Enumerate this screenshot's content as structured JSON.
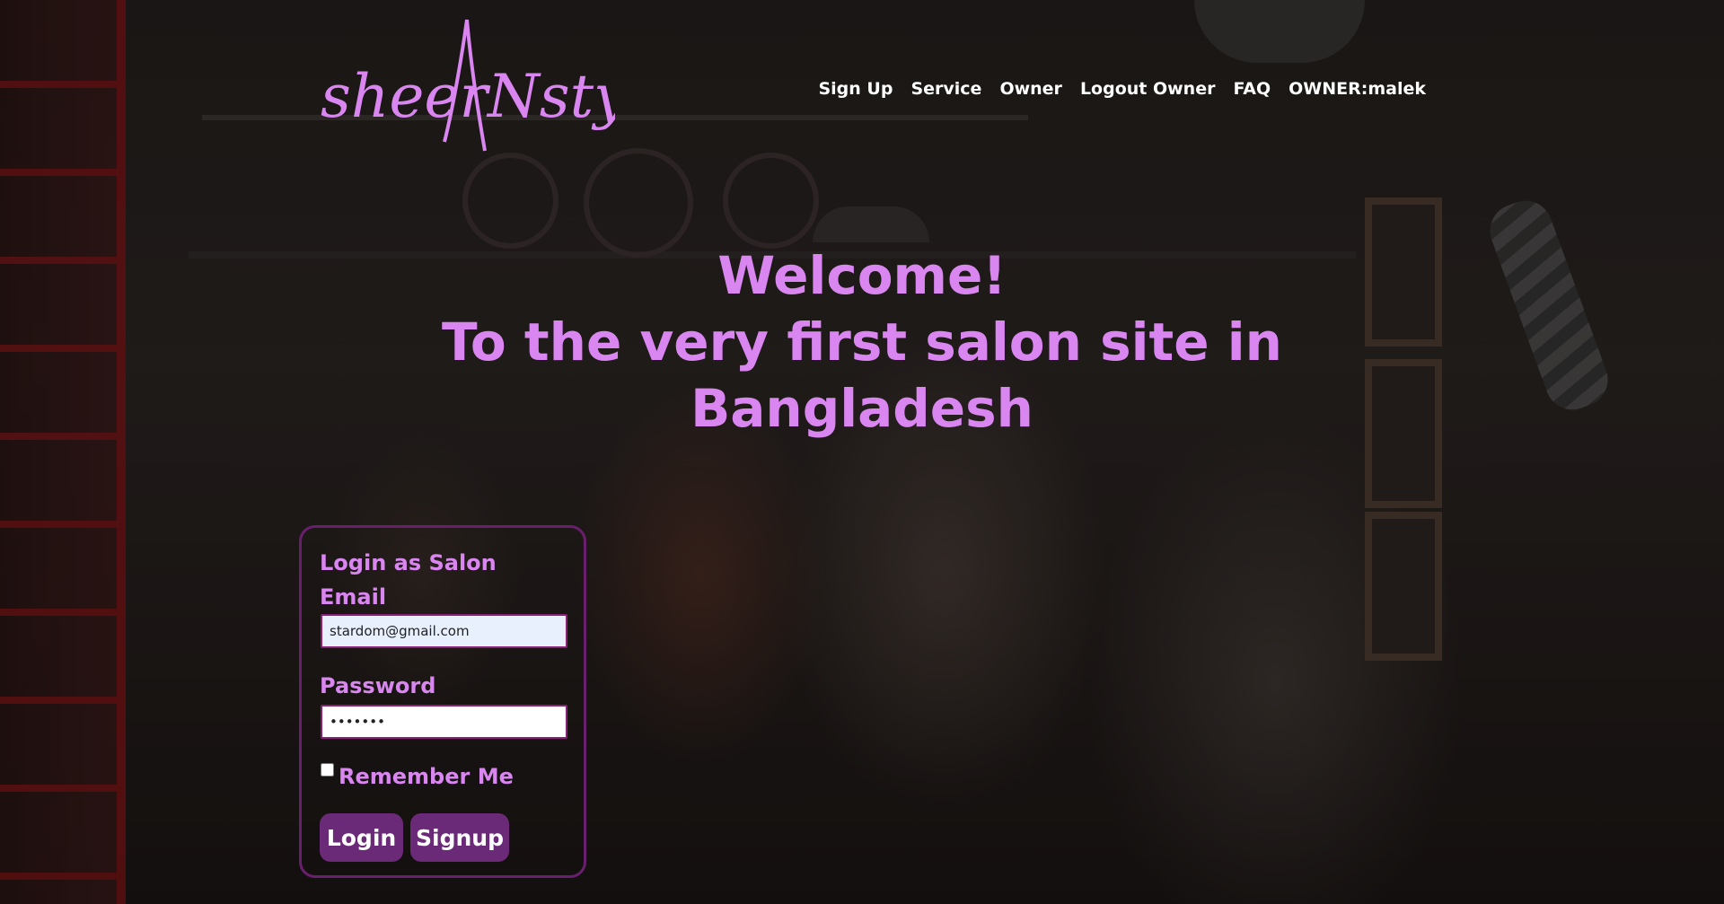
{
  "header": {
    "logo_text": "sheerNstyle",
    "nav": [
      "Sign Up",
      "Service",
      "Owner",
      "Logout Owner",
      "FAQ",
      "OWNER:malek"
    ]
  },
  "hero": {
    "line1": "Welcome!",
    "line2": "To the very first salon site in",
    "line3": "Bangladesh"
  },
  "login": {
    "title": "Login as Salon",
    "email_label": "Email",
    "email_value": "stardom@gmail.com",
    "password_label": "Password",
    "password_value": "•••••••",
    "remember_label": "Remember Me",
    "login_button": "Login",
    "signup_button": "Signup"
  },
  "colors": {
    "accent_text": "#d986f0",
    "button_bg": "#6b2a78",
    "card_border": "#6a1f6e"
  }
}
